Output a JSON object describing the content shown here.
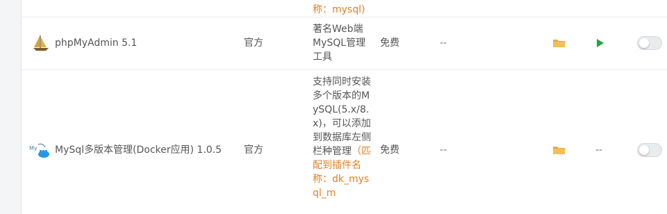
{
  "top_row": {
    "desc_tail": "称：mysql)"
  },
  "plugins": [
    {
      "name": "phpMyAdmin 5.1",
      "icon": "sailboat-icon",
      "type": "官方",
      "desc": "著名Web端MySQL管理工具",
      "desc_highlight": "",
      "price": "免费",
      "expire": "--",
      "status": "play-icon"
    },
    {
      "name": "MySql多版本管理(Docker应用) 1.0.5",
      "icon": "mysql-docker-icon",
      "type": "官方",
      "desc": "支持同时安装多个版本的MySQL(5.x/8.x)，可以添加到数据库左侧栏种管理",
      "desc_highlight": "（匹配到插件名称：dk_mysql_m",
      "price": "免费",
      "expire": "--",
      "status": "--"
    }
  ],
  "colors": {
    "highlight": "#e67e22",
    "folder": "#f0ad4e",
    "play": "#20a53a",
    "toggle_off": "#e9ecef"
  }
}
